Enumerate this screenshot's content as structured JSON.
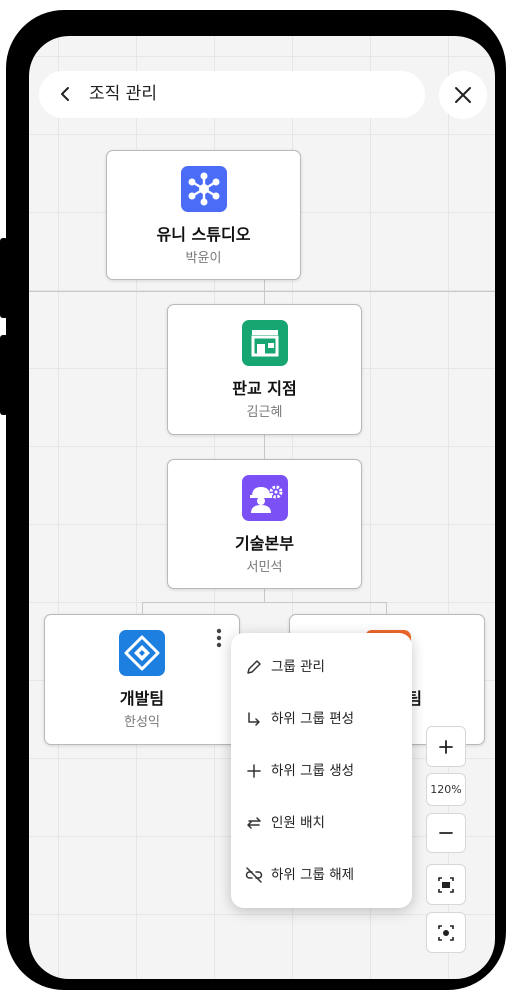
{
  "header": {
    "title": "조직 관리"
  },
  "org": {
    "root": {
      "name": "유니 스튜디오",
      "leader": "박윤이"
    },
    "branch": {
      "name": "판교 지점",
      "leader": "김근혜"
    },
    "division": {
      "name": "기술본부",
      "leader": "서민석"
    },
    "team_dev": {
      "name": "개발팀",
      "leader": "한성익"
    },
    "team_partial": {
      "name_visible_fragment": "팀"
    }
  },
  "context_menu": {
    "items": [
      {
        "label": "그룹 관리",
        "icon": "pencil-icon"
      },
      {
        "label": "하위 그룹 편성",
        "icon": "arrow-down-right-icon"
      },
      {
        "label": "하위 그룹 생성",
        "icon": "plus-icon"
      },
      {
        "label": "인원 배치",
        "icon": "swap-arrows-icon"
      },
      {
        "label": "하위 그룹 해제",
        "icon": "unlink-icon"
      }
    ]
  },
  "zoom": {
    "level": "120%"
  },
  "colors": {
    "root_icon": "#4a6cf7",
    "branch_icon": "#17a672",
    "division_icon": "#7b51f5",
    "team_dev_icon": "#1d7fe0",
    "team_partial_icon": "#f06a2a"
  }
}
